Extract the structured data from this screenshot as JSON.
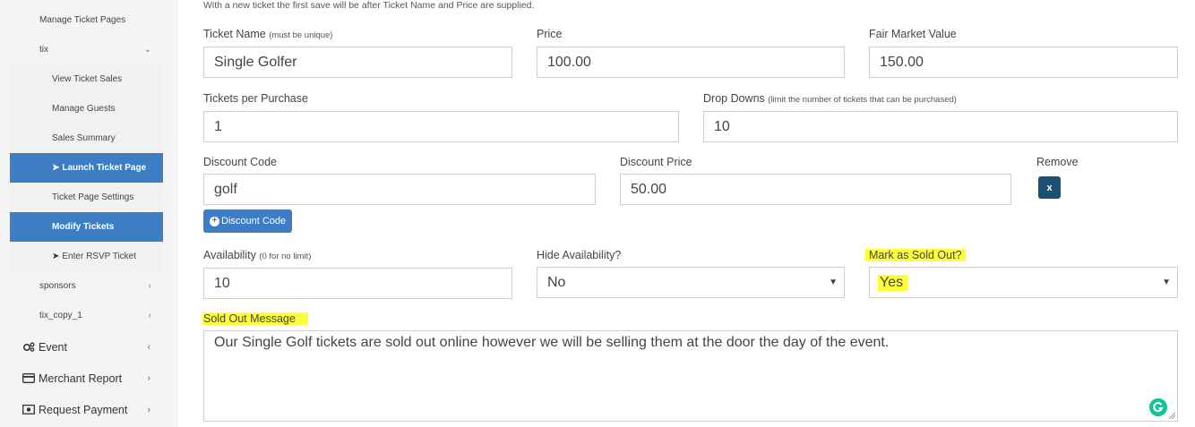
{
  "sidebar": {
    "manage_ticket_pages": "Manage Ticket Pages",
    "tix": "tix",
    "view_ticket_sales": "View Ticket Sales",
    "manage_guests": "Manage Guests",
    "sales_summary": "Sales Summary",
    "launch_ticket_page": "Launch Ticket Page",
    "ticket_page_settings": "Ticket Page Settings",
    "modify_tickets": "Modify Tickets",
    "enter_rsvp_ticket": "Enter RSVP Ticket",
    "sponsors": "sponsors",
    "tix_copy_1": "tix_copy_1",
    "event": "Event",
    "merchant_report": "Merchant Report",
    "request_payment": "Request Payment"
  },
  "form": {
    "hint": "With a new ticket the first save will be after Ticket Name and Price are supplied.",
    "ticket_name_label": "Ticket Name",
    "ticket_name_note": "(must be unique)",
    "ticket_name_value": "Single Golfer",
    "price_label": "Price",
    "price_value": "100.00",
    "fmv_label": "Fair Market Value",
    "fmv_value": "150.00",
    "tpp_label": "Tickets per Purchase",
    "tpp_value": "1",
    "dropdowns_label": "Drop Downs",
    "dropdowns_note": "(limit the number of tickets that can be purchased)",
    "dropdowns_value": "10",
    "discount_code_label": "Discount Code",
    "discount_code_value": "golf",
    "discount_price_label": "Discount Price",
    "discount_price_value": "50.00",
    "remove_label": "Remove",
    "remove_button": "x",
    "discount_code_button": "Discount Code",
    "availability_label": "Availability",
    "availability_note": "(0 for no limit)",
    "availability_value": "10",
    "hide_availability_label": "Hide Availability?",
    "hide_availability_value": "No",
    "mark_sold_out_label": "Mark as Sold Out?",
    "mark_sold_out_value": "Yes",
    "sold_out_message_label": "Sold Out Message",
    "sold_out_message_value": "Our Single Golf tickets are sold out online however we will be selling them at the door the day of the event."
  },
  "colors": {
    "accent": "#3c7dc4",
    "highlight": "#fdfd3a",
    "remove_button": "#1d4f72",
    "grammarly": "#15c39a"
  },
  "icons": [
    "rocket-icon",
    "cogs-icon",
    "credit-card-icon",
    "money-icon",
    "chevron-left-icon",
    "chevron-right-icon",
    "chevron-down-icon",
    "plus-circle-icon",
    "grammarly-icon"
  ]
}
